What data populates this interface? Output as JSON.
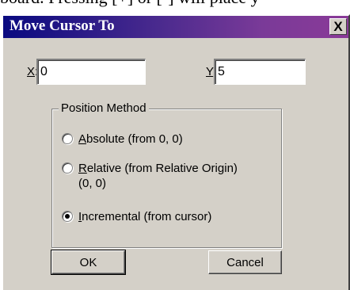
{
  "background": {
    "partial_text": "board. Pressing [+] or [-] will place y"
  },
  "dialog": {
    "title": "Move Cursor To",
    "close_label": "X",
    "x_field": {
      "label_mnemonic": "X",
      "label_rest": ":",
      "value": "0"
    },
    "y_field": {
      "label_mnemonic": "Y",
      "label_rest": ":",
      "value": "5"
    },
    "position_method": {
      "title": "Position Method",
      "options": [
        {
          "mnemonic": "A",
          "rest": "bsolute (from 0, 0)",
          "selected": false
        },
        {
          "mnemonic": "R",
          "rest": "elative (from Relative Origin)",
          "extra_line": "(0, 0)",
          "selected": false
        },
        {
          "mnemonic": "I",
          "rest": "ncremental (from cursor)",
          "selected": true
        }
      ]
    },
    "ok_label": "OK",
    "cancel_label": "Cancel"
  },
  "colors": {
    "titlebar_start": "#0a0a80",
    "titlebar_end": "#8a3a98",
    "dialog_face": "#d4d0c8"
  }
}
